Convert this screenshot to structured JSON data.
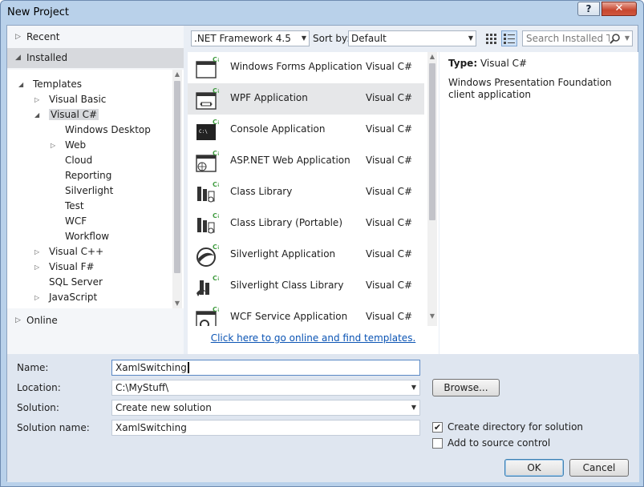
{
  "window": {
    "title": "New Project",
    "help_label": "?",
    "close_label": "✕"
  },
  "left": {
    "recent": "Recent",
    "installed": "Installed",
    "online": "Online",
    "tree": [
      {
        "label": "Templates",
        "level": 0,
        "arrow": "◢"
      },
      {
        "label": "Visual Basic",
        "level": 1,
        "arrow": "▷"
      },
      {
        "label": "Visual C#",
        "level": 1,
        "arrow": "◢",
        "selected": true
      },
      {
        "label": "Windows Desktop",
        "level": 2,
        "arrow": ""
      },
      {
        "label": "Web",
        "level": 2,
        "arrow": "▷"
      },
      {
        "label": "Cloud",
        "level": 2,
        "arrow": ""
      },
      {
        "label": "Reporting",
        "level": 2,
        "arrow": ""
      },
      {
        "label": "Silverlight",
        "level": 2,
        "arrow": ""
      },
      {
        "label": "Test",
        "level": 2,
        "arrow": ""
      },
      {
        "label": "WCF",
        "level": 2,
        "arrow": ""
      },
      {
        "label": "Workflow",
        "level": 2,
        "arrow": ""
      },
      {
        "label": "Visual C++",
        "level": 1,
        "arrow": "▷"
      },
      {
        "label": "Visual F#",
        "level": 1,
        "arrow": "▷"
      },
      {
        "label": "SQL Server",
        "level": 1,
        "arrow": ""
      },
      {
        "label": "JavaScript",
        "level": 1,
        "arrow": "▷"
      }
    ]
  },
  "toolbar": {
    "framework": ".NET Framework 4.5",
    "sort_label": "Sort by:",
    "sort_value": "Default",
    "search_placeholder": "Search Installed Ter"
  },
  "templates": [
    {
      "name": "Windows Forms Application",
      "lang": "Visual C#",
      "icon": "winforms-icon"
    },
    {
      "name": "WPF Application",
      "lang": "Visual C#",
      "icon": "wpf-icon",
      "selected": true
    },
    {
      "name": "Console Application",
      "lang": "Visual C#",
      "icon": "console-icon"
    },
    {
      "name": "ASP.NET Web Application",
      "lang": "Visual C#",
      "icon": "web-app-icon"
    },
    {
      "name": "Class Library",
      "lang": "Visual C#",
      "icon": "class-library-icon"
    },
    {
      "name": "Class Library (Portable)",
      "lang": "Visual C#",
      "icon": "portable-library-icon"
    },
    {
      "name": "Silverlight Application",
      "lang": "Visual C#",
      "icon": "silverlight-icon"
    },
    {
      "name": "Silverlight Class Library",
      "lang": "Visual C#",
      "icon": "silverlight-library-icon"
    },
    {
      "name": "WCF Service Application",
      "lang": "Visual C#",
      "icon": "wcf-icon"
    }
  ],
  "online_link": "Click here to go online and find templates.",
  "details": {
    "type_label": "Type:",
    "type_value": "Visual C#",
    "description": "Windows Presentation Foundation client application"
  },
  "form": {
    "name_label": "Name:",
    "name_value": "XamlSwitching",
    "location_label": "Location:",
    "location_value": "C:\\MyStuff\\",
    "solution_label": "Solution:",
    "solution_value": "Create new solution",
    "solution_name_label": "Solution name:",
    "solution_name_value": "XamlSwitching",
    "browse_label": "Browse...",
    "create_dir_label": "Create directory for solution",
    "create_dir_checked": true,
    "source_control_label": "Add to source control",
    "source_control_checked": false,
    "ok_label": "OK",
    "cancel_label": "Cancel"
  },
  "colors": {
    "accent": "#0b54b4",
    "selected": "#e6e7e9",
    "csharp_badge": "#3f9b3f"
  }
}
